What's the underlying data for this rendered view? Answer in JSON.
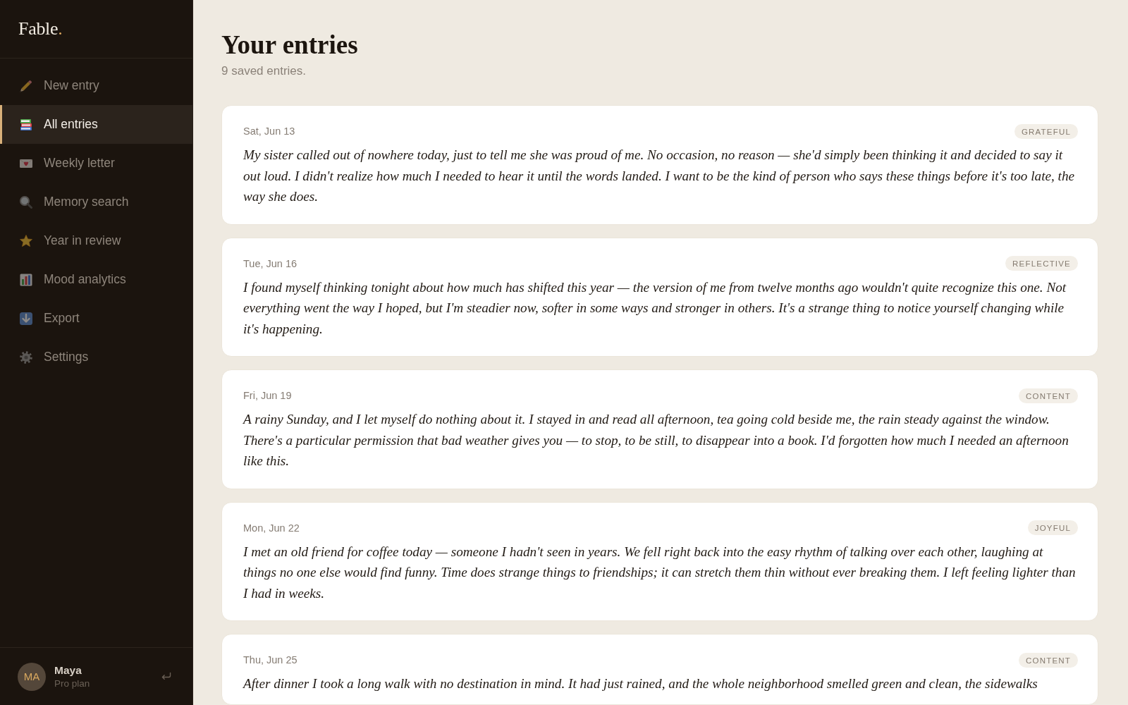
{
  "sidebar": {
    "logo": {
      "name": "Fable",
      "dot": "."
    },
    "nav": [
      {
        "label": "New entry",
        "selected": false
      },
      {
        "label": "All entries",
        "selected": true
      },
      {
        "label": "Weekly letter",
        "selected": false
      },
      {
        "label": "Memory search",
        "selected": false
      },
      {
        "label": "Year in review",
        "selected": false
      },
      {
        "label": "Mood analytics",
        "selected": false
      },
      {
        "label": "Export",
        "selected": false
      },
      {
        "label": "Settings",
        "selected": false
      }
    ],
    "user": {
      "initials": "MA",
      "name": "Maya",
      "plan": "Pro plan"
    }
  },
  "main": {
    "title": "Your entries",
    "subtitle": "9 saved entries.",
    "entries": [
      {
        "date": "Sat, Jun 13",
        "mood": "GRATEFUL",
        "text": "My sister called out of nowhere today, just to tell me she was proud of me. No occasion, no reason — she'd simply been thinking it and decided to say it out loud. I didn't realize how much I needed to hear it until the words landed. I want to be the kind of person who says these things before it's too late, the way she does."
      },
      {
        "date": "Tue, Jun 16",
        "mood": "REFLECTIVE",
        "text": "I found myself thinking tonight about how much has shifted this year — the version of me from twelve months ago wouldn't quite recognize this one. Not everything went the way I hoped, but I'm steadier now, softer in some ways and stronger in others. It's a strange thing to notice yourself changing while it's happening."
      },
      {
        "date": "Fri, Jun 19",
        "mood": "CONTENT",
        "text": "A rainy Sunday, and I let myself do nothing about it. I stayed in and read all afternoon, tea going cold beside me, the rain steady against the window. There's a particular permission that bad weather gives you — to stop, to be still, to disappear into a book. I'd forgotten how much I needed an afternoon like this."
      },
      {
        "date": "Mon, Jun 22",
        "mood": "JOYFUL",
        "text": "I met an old friend for coffee today — someone I hadn't seen in years. We fell right back into the easy rhythm of talking over each other, laughing at things no one else would find funny. Time does strange things to friendships; it can stretch them thin without ever breaking them. I left feeling lighter than I had in weeks."
      },
      {
        "date": "Thu, Jun 25",
        "mood": "CONTENT",
        "text": "After dinner I took a long walk with no destination in mind. It had just rained, and the whole neighborhood smelled green and clean, the sidewalks"
      }
    ]
  }
}
